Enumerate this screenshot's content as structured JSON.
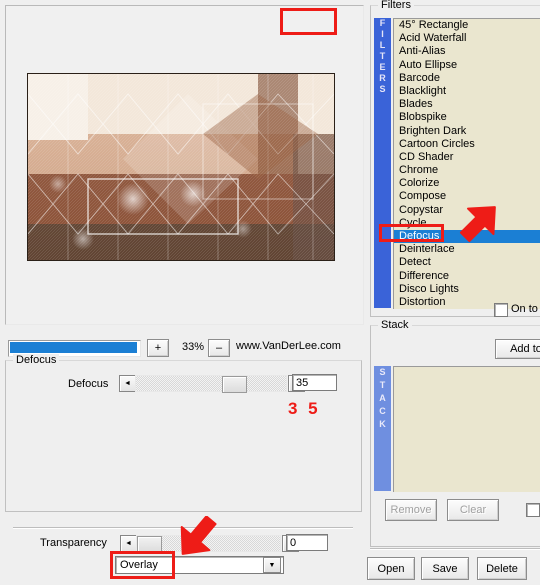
{
  "preview": {
    "zoom_percent": "33%",
    "zoom_in_label": "+",
    "zoom_out_label": "–",
    "brand": "www.VanDerLee.com"
  },
  "defocus_group": {
    "title": "Defocus",
    "slider_label": "Defocus",
    "value": "35",
    "annotation": "3 5",
    "spin_left": "◄",
    "spin_right": "►"
  },
  "transparency": {
    "label": "Transparency",
    "value": "0",
    "spin_left": "◄",
    "spin_right": "►",
    "blend_mode": "Overlay",
    "dropdown_arrow": "▼"
  },
  "filters_panel": {
    "title": "Filters",
    "sidebar_text": [
      "F",
      "I",
      "L",
      "T",
      "E",
      "R",
      "S"
    ],
    "items": [
      {
        "label": "45° Rectangle",
        "selected": false
      },
      {
        "label": "Acid Waterfall",
        "selected": false
      },
      {
        "label": "Anti-Alias",
        "selected": false
      },
      {
        "label": "Auto Ellipse",
        "selected": false
      },
      {
        "label": "Barcode",
        "selected": false
      },
      {
        "label": "Blacklight",
        "selected": false
      },
      {
        "label": "Blades",
        "selected": false
      },
      {
        "label": "Blobspike",
        "selected": false
      },
      {
        "label": "Brighten Dark",
        "selected": false
      },
      {
        "label": "Cartoon Circles",
        "selected": false
      },
      {
        "label": "CD Shader",
        "selected": false
      },
      {
        "label": "Chrome",
        "selected": false
      },
      {
        "label": "Colorize",
        "selected": false
      },
      {
        "label": "Compose",
        "selected": false
      },
      {
        "label": "Copystar",
        "selected": false
      },
      {
        "label": "Cycle",
        "selected": false
      },
      {
        "label": "Defocus",
        "selected": true
      },
      {
        "label": "Deinterlace",
        "selected": false
      },
      {
        "label": "Detect",
        "selected": false
      },
      {
        "label": "Difference",
        "selected": false
      },
      {
        "label": "Disco Lights",
        "selected": false
      },
      {
        "label": "Distortion",
        "selected": false
      }
    ],
    "onto_label": "On to"
  },
  "stack_panel": {
    "title": "Stack",
    "add_to_label": "Add to",
    "sidebar_text": [
      "S",
      "T",
      "A",
      "C",
      "K"
    ],
    "remove_label": "Remove",
    "clear_label": "Clear",
    "items": []
  },
  "bottom_buttons": {
    "open_label": "Open",
    "save_label": "Save",
    "delete_label": "Delete"
  },
  "colors": {
    "selection_blue": "#1b7fd4",
    "annotation_red": "#ee1c17",
    "list_background": "#eae6cf",
    "sidebar_blue": "#3a63d8"
  }
}
